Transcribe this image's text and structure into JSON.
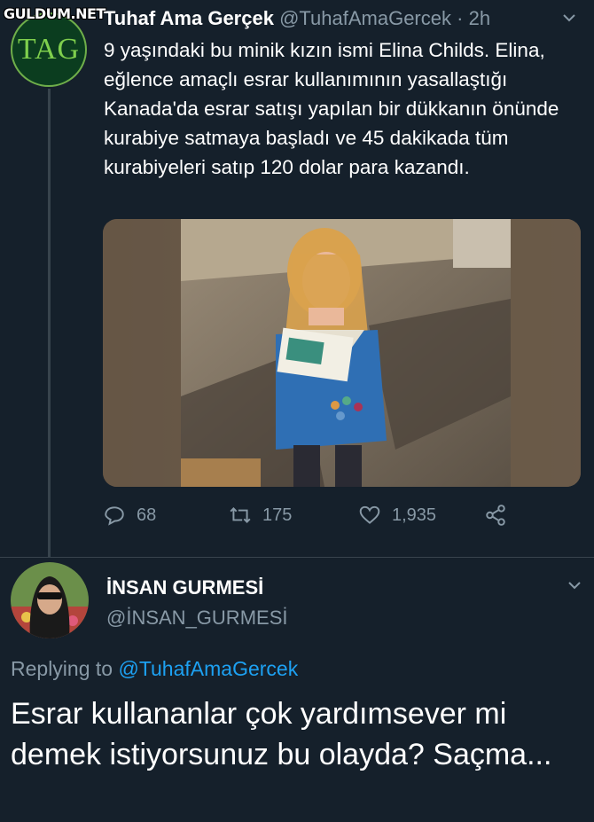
{
  "watermark": "GULDUM.NET",
  "tweet": {
    "avatar_text": "TAG",
    "display_name": "Tuhaf Ama Gerçek",
    "handle": "@TuhafAmaGercek",
    "separator": "·",
    "time": "2h",
    "text": "9 yaşındaki bu minik kızın ismi Elina Childs. Elina, eğlence amaçlı esrar kullanımının yasallaştığı Kanada'da esrar satışı yapılan bir dükkanın önünde kurabiye satmaya başladı ve 45 dakikada tüm kurabiyeleri satıp 120 dolar para kazandı.",
    "actions": {
      "replies": "68",
      "retweets": "175",
      "likes": "1,935"
    }
  },
  "reply": {
    "display_name": "İNSAN GURMESİ",
    "handle": "@İNSAN_GURMESİ",
    "replying_prefix": "Replying to",
    "replying_to": "@TuhafAmaGercek",
    "text": "Esrar kullananlar çok yardımsever mi demek istiyorsunuz bu olayda? Saçma..."
  },
  "colors": {
    "background": "#15202b",
    "secondary_text": "#8899a6",
    "link": "#1da1f2",
    "border": "#38444d"
  }
}
